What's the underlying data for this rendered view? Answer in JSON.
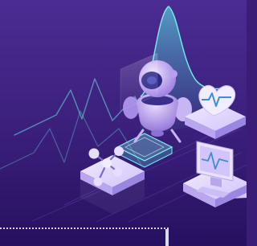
{
  "colors": {
    "bg_top": "#4a2a92",
    "bg_mid": "#3a1f7a",
    "bg_bottom": "#2a1262",
    "accent_cyan": "#4fe3e0",
    "accent_teal": "#2fb9b3",
    "robot_body": "#c9b7f2",
    "robot_shade": "#8f73d8",
    "robot_band": "#3a2f8a",
    "tile_top": "#e9e1ff",
    "tile_side": "#b9a6ee",
    "line_glow": "#7de6e6",
    "dash": "#d9d9ee"
  },
  "icons": {
    "robot": "robot-icon",
    "heart": "heart-rate-icon",
    "molecule": "molecule-icon",
    "monitor": "monitor-icon",
    "wave": "wave-chart-icon"
  }
}
